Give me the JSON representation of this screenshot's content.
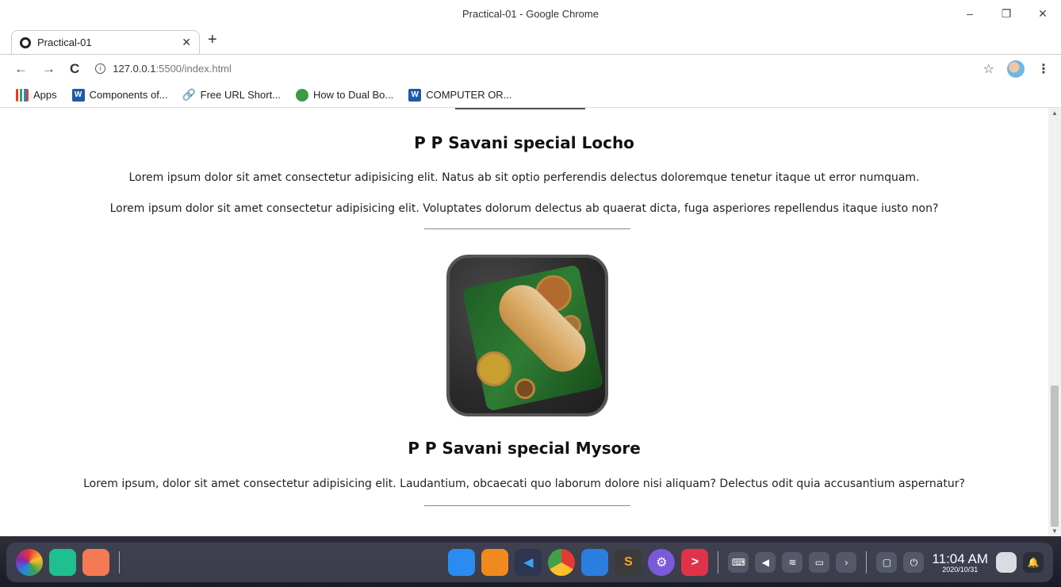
{
  "window": {
    "title": "Practical-01 - Google Chrome",
    "minimize": "–",
    "restore": "❐",
    "close": "✕"
  },
  "tab": {
    "title": "Practical-01",
    "close": "✕",
    "new_tab": "+"
  },
  "toolbar": {
    "back": "←",
    "forward": "→",
    "reload": "C",
    "url_host": "127.0.0.1",
    "url_path": ":5500/index.html",
    "star": "☆",
    "menu": "⋮"
  },
  "bookmarks": [
    {
      "label": "Apps",
      "icon": "apps-grid-icon"
    },
    {
      "label": "Components of...",
      "icon": "word-icon"
    },
    {
      "label": "Free URL Short...",
      "icon": "link-icon"
    },
    {
      "label": "How to Dual Bo...",
      "icon": "site-icon"
    },
    {
      "label": "COMPUTER OR...",
      "icon": "word-icon"
    }
  ],
  "content": {
    "section1": {
      "heading": "P P Savani special Locho",
      "para1": "Lorem ipsum dolor sit amet consectetur adipisicing elit. Natus ab sit optio perferendis delectus doloremque tenetur itaque ut error numquam.",
      "para2": "Lorem ipsum dolor sit amet consectetur adipisicing elit. Voluptates dolorum delectus ab quaerat dicta, fuga asperiores repellendus itaque iusto non?"
    },
    "section2": {
      "heading": "P P Savani special Mysore",
      "para1": "Lorem ipsum, dolor sit amet consectetur adipisicing elit. Laudantium, obcaecati quo laborum dolore nisi aliquam? Delectus odit quia accusantium aspernatur?"
    }
  },
  "scrollbar": {
    "position_fraction": 0.65
  },
  "taskbar": {
    "clock_time": "11:04 AM",
    "clock_date": "2020/10/31"
  },
  "colors": {
    "taskbar_bg": "#1a1b26",
    "heading": "#111111"
  }
}
